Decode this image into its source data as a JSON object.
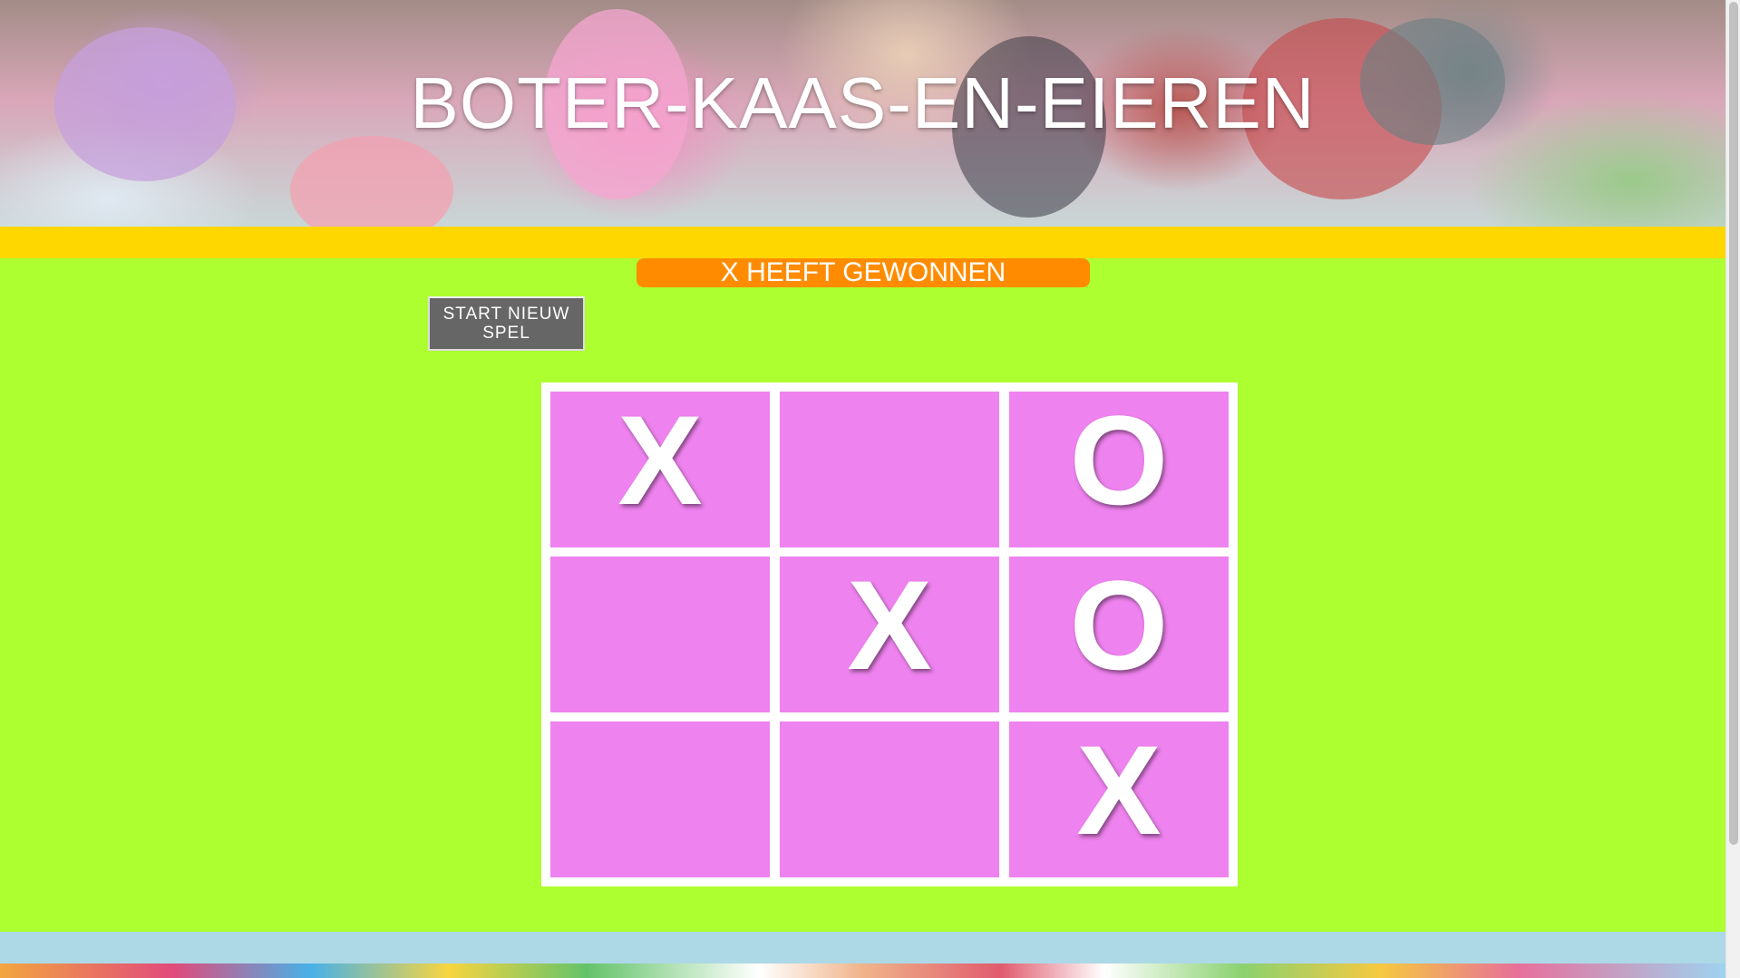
{
  "header": {
    "title": "BOTER-KAAS-EN-EIEREN"
  },
  "status": {
    "message": "X HEEFT GEWONNEN"
  },
  "controls": {
    "reset_label": "START NIEUW SPEL"
  },
  "board": {
    "cells": [
      "X",
      "",
      "O",
      "",
      "X",
      "O",
      "",
      "",
      "X"
    ]
  },
  "colors": {
    "background": "#adff2f",
    "banner_stripe": "#ffd700",
    "status_background": "#ff8c00",
    "cell_background": "#ee82ee",
    "footer_stripe": "#add8e6",
    "button_background": "#666666"
  }
}
